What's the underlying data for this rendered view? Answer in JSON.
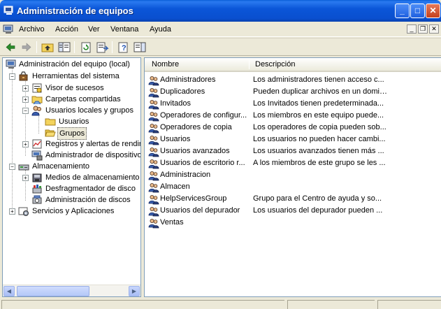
{
  "window": {
    "title": "Administración de equipos",
    "buttons": {
      "minimize": "_",
      "maximize": "□",
      "close": "✕"
    }
  },
  "menu": {
    "items": [
      "Archivo",
      "Acción",
      "Ver",
      "Ventana",
      "Ayuda"
    ],
    "mdi": {
      "minimize": "_",
      "restore": "❐",
      "close": "✕"
    }
  },
  "toolbar": {
    "icons": [
      "back-icon",
      "forward-icon",
      "up-folder-icon",
      "show-tree-icon",
      "refresh-icon",
      "export-list-icon",
      "help-icon",
      "show-action-pane-icon"
    ]
  },
  "tree": {
    "root": "Administración del equipo (local)",
    "system_tools": "Herramientas del sistema",
    "event_viewer": "Visor de sucesos",
    "shared_folders": "Carpetas compartidas",
    "local_users": "Usuarios locales y grupos",
    "users": "Usuarios",
    "groups": "Grupos",
    "perf_logs": "Registros y alertas de rendir",
    "device_manager": "Administrador de dispositivo",
    "storage": "Almacenamiento",
    "removable_storage": "Medios de almacenamiento e",
    "defrag": "Desfragmentador de disco",
    "disk_mgmt": "Administración de discos",
    "services": "Servicios y Aplicaciones",
    "expanders": {
      "plus": "+",
      "minus": "−"
    }
  },
  "scrollbar": {
    "left": "◀",
    "right": "▶"
  },
  "list": {
    "columns": {
      "name": "Nombre",
      "description": "Descripción"
    },
    "rows": [
      {
        "name": "Administradores",
        "description": "Los administradores tienen acceso c..."
      },
      {
        "name": "Duplicadores",
        "description": "Pueden duplicar archivos en un dominio"
      },
      {
        "name": "Invitados",
        "description": "Los Invitados tienen predeterminada..."
      },
      {
        "name": "Operadores de configur...",
        "description": "Los miembros en este equipo puede..."
      },
      {
        "name": "Operadores de copia",
        "description": "Los operadores de copia pueden sob..."
      },
      {
        "name": "Usuarios",
        "description": "Los usuarios no pueden hacer cambi..."
      },
      {
        "name": "Usuarios avanzados",
        "description": "Los usuarios avanzados tienen más ..."
      },
      {
        "name": "Usuarios de escritorio r...",
        "description": "A los miembros de este grupo se les ..."
      },
      {
        "name": "Administracion",
        "description": ""
      },
      {
        "name": "Almacen",
        "description": ""
      },
      {
        "name": "HelpServicesGroup",
        "description": "Grupo para el Centro de ayuda y so..."
      },
      {
        "name": "Usuarios del depurador",
        "description": "Los usuarios del depurador pueden ..."
      },
      {
        "name": "Ventas",
        "description": ""
      }
    ]
  },
  "colors": {
    "titlebar": "#0b56d8",
    "chrome": "#ece9d8",
    "pane_border": "#7f9db9"
  }
}
